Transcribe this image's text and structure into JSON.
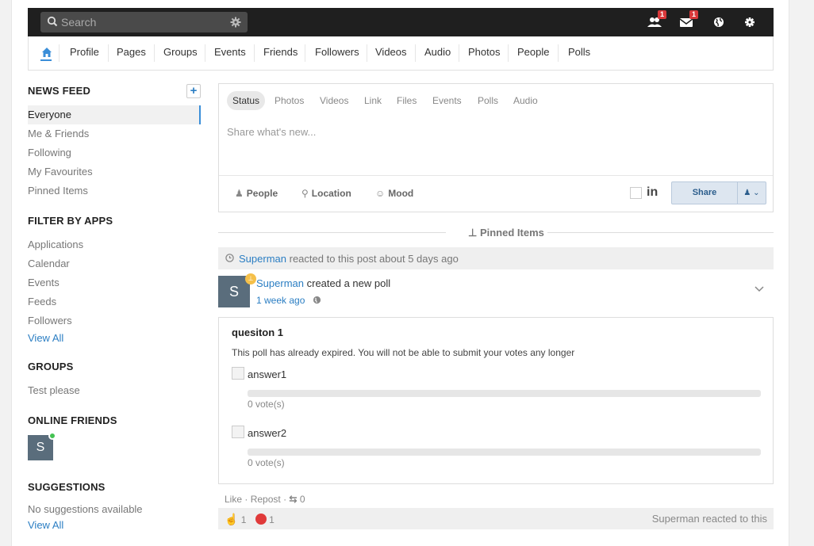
{
  "header": {
    "search_placeholder": "Search",
    "friend_requests_badge": "1",
    "messages_badge": "1"
  },
  "nav": {
    "items": [
      "Profile",
      "Pages",
      "Groups",
      "Events",
      "Friends",
      "Followers",
      "Videos",
      "Audio",
      "Photos",
      "People",
      "Polls"
    ]
  },
  "sidebar": {
    "news_feed_title": "NEWS FEED",
    "news_feed_items": [
      "Everyone",
      "Me & Friends",
      "Following",
      "My Favourites",
      "Pinned Items"
    ],
    "filter_title": "FILTER BY APPS",
    "filter_items": [
      "Applications",
      "Calendar",
      "Events",
      "Feeds",
      "Followers"
    ],
    "filter_view_all": "View All",
    "groups_title": "GROUPS",
    "groups_items": [
      "Test please"
    ],
    "online_friends_title": "ONLINE FRIENDS",
    "friend_initial": "S",
    "suggestions_title": "SUGGESTIONS",
    "suggestions_empty": "No suggestions available",
    "suggestions_view_all": "View All"
  },
  "composer": {
    "tabs": [
      "Status",
      "Photos",
      "Videos",
      "Link",
      "Files",
      "Events",
      "Polls",
      "Audio"
    ],
    "placeholder": "Share what's new...",
    "people_label": "People",
    "location_label": "Location",
    "mood_label": "Mood",
    "linkedin_label": "in",
    "share_label": "Share"
  },
  "feed": {
    "pinned_label": "Pinned Items",
    "reacted_user": "Superman",
    "reacted_text": "reacted to this post about 5 days ago",
    "post_initial": "S",
    "post_author": "Superman",
    "post_action": "created a new poll",
    "post_time": "1 week ago",
    "poll": {
      "question": "quesiton 1",
      "expired_note": "This poll has already expired. You will not be able to submit your votes any longer",
      "answers": [
        {
          "label": "answer1",
          "votes": "0 vote(s)",
          "fraction": 0
        },
        {
          "label": "answer2",
          "votes": "0 vote(s)",
          "fraction": 0
        }
      ]
    },
    "like_label": "Like",
    "repost_label": "Repost",
    "repost_count": "0",
    "like_count": "1",
    "angry_count": "1",
    "reacted_summary": "Superman reacted to this"
  },
  "colors": {
    "accent": "#2b7ec3",
    "topbar": "#1f1f1f",
    "badge": "#d9383a",
    "online": "#44c253"
  }
}
